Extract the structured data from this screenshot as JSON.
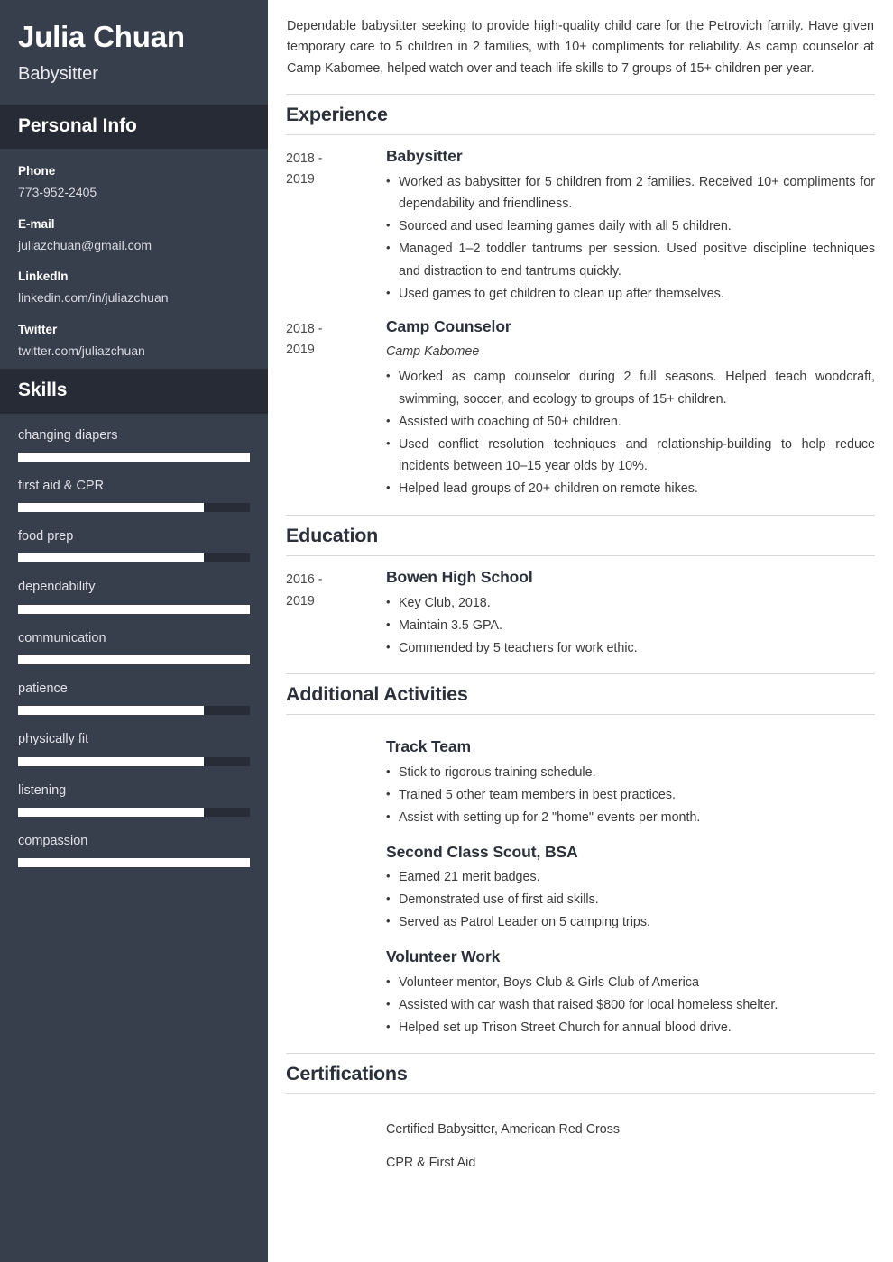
{
  "theme": {
    "sidebar_bg": "#373e4c",
    "sidebar_band_bg": "#262b36",
    "skill_fill": "#ffffff",
    "skill_track": "#272c37",
    "heading_color": "#2b303b",
    "body_text": "#3a3a3a",
    "rule_color": "#d8d8d8"
  },
  "sidebar": {
    "name": "Julia Chuan",
    "job_title": "Babysitter",
    "personal_info_heading": "Personal Info",
    "contacts": [
      {
        "label": "Phone",
        "value": "773-952-2405"
      },
      {
        "label": "E-mail",
        "value": "juliazchuan@gmail.com"
      },
      {
        "label": "LinkedIn",
        "value": "linkedin.com/in/juliazchuan"
      },
      {
        "label": "Twitter",
        "value": "twitter.com/juliazchuan"
      }
    ],
    "skills_heading": "Skills",
    "skills": [
      {
        "name": "changing diapers",
        "level": 100
      },
      {
        "name": "first aid & CPR",
        "level": 80
      },
      {
        "name": "food prep",
        "level": 80
      },
      {
        "name": "dependability",
        "level": 100
      },
      {
        "name": "communication",
        "level": 100
      },
      {
        "name": "patience",
        "level": 80
      },
      {
        "name": "physically fit",
        "level": 80
      },
      {
        "name": "listening",
        "level": 80
      },
      {
        "name": "compassion",
        "level": 100
      }
    ]
  },
  "main": {
    "summary": "Dependable babysitter seeking to provide high-quality child care for the Petrovich family. Have given temporary care to 5 children in 2 families, with 10+ compliments for reliability. As camp counselor at Camp Kabomee, helped watch over and teach life skills to 7 groups of 15+ children per year.",
    "experience": {
      "heading": "Experience",
      "entries": [
        {
          "dates_line1": "2018 -",
          "dates_line2": "2019",
          "title": "Babysitter",
          "subtitle": "",
          "bullets": [
            "Worked as babysitter for 5 children from 2 families. Received 10+ compliments for dependability and friendliness.",
            "Sourced and used learning games daily with all 5 children.",
            "Managed 1–2 toddler tantrums per session. Used positive discipline techniques and distraction to end tantrums quickly.",
            "Used games to get children to clean up after themselves."
          ]
        },
        {
          "dates_line1": "2018 -",
          "dates_line2": "2019",
          "title": "Camp Counselor",
          "subtitle": "Camp Kabomee",
          "bullets": [
            "Worked as camp counselor during 2 full seasons. Helped teach woodcraft, swimming, soccer, and ecology to groups of 15+ children.",
            "Assisted with coaching of 50+ children.",
            "Used conflict resolution techniques and relationship-building to help reduce incidents between 10–15 year olds by 10%.",
            "Helped lead groups of 20+ children on remote hikes."
          ]
        }
      ]
    },
    "education": {
      "heading": "Education",
      "entries": [
        {
          "dates_line1": "2016 -",
          "dates_line2": "2019",
          "title": "Bowen High School",
          "subtitle": "",
          "bullets": [
            "Key Club, 2018.",
            "Maintain 3.5 GPA.",
            "Commended by 5 teachers for work ethic."
          ]
        }
      ]
    },
    "activities": {
      "heading": "Additional Activities",
      "entries": [
        {
          "title": "Track Team",
          "bullets": [
            "Stick to rigorous training schedule.",
            "Trained 5 other team members in best practices.",
            "Assist with setting up for 2 \"home\" events per month."
          ]
        },
        {
          "title": "Second Class Scout, BSA",
          "bullets": [
            "Earned 21 merit badges.",
            "Demonstrated use of first aid skills.",
            "Served as Patrol Leader on 5 camping trips."
          ]
        },
        {
          "title": "Volunteer Work",
          "bullets": [
            "Volunteer mentor, Boys Club & Girls Club of America",
            "Assisted with car wash that raised $800 for local homeless shelter.",
            "Helped set up Trison Street Church for annual blood drive."
          ]
        }
      ]
    },
    "certifications": {
      "heading": "Certifications",
      "items": [
        "Certified Babysitter, American Red Cross",
        "CPR & First Aid"
      ]
    }
  }
}
